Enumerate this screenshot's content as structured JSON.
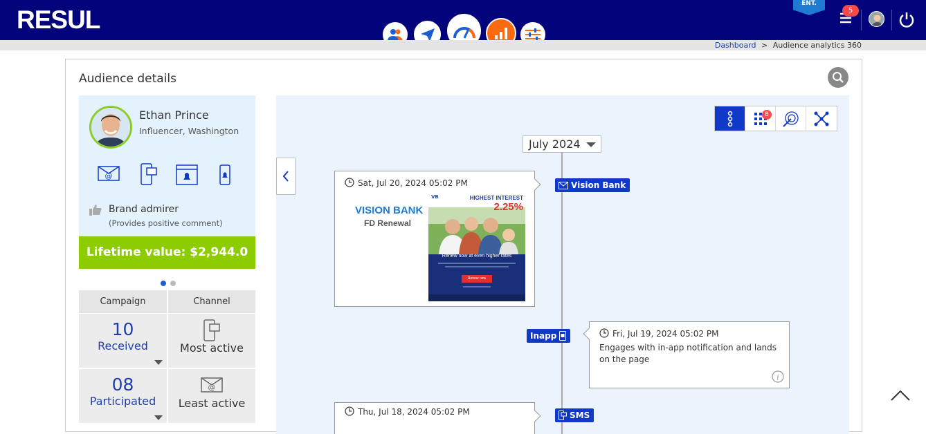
{
  "header": {
    "logo": "RESUL",
    "ent_badge": "ENT.",
    "notification_count": "5"
  },
  "breadcrumb": {
    "home": "Dashboard",
    "separator": ">",
    "current": "Audience analytics 360"
  },
  "card": {
    "title": "Audience details"
  },
  "profile": {
    "name": "Ethan Prince",
    "subtitle": "Influencer, Washington",
    "persona": "Brand admirer",
    "persona_note": "(Provides positive comment)",
    "lifetime_value": "Lifetime value: $2,944.0"
  },
  "stats": {
    "campaign_header": "Campaign",
    "channel_header": "Channel",
    "received_count": "10",
    "received_label": "Received",
    "most_active_label": "Most active",
    "participated_count": "08",
    "participated_label": "Participated",
    "least_active_label": "Least active"
  },
  "timeline": {
    "month": "July 2024",
    "filter_badge": "8",
    "events": [
      {
        "time": "Sat, Jul 20, 2024 05:02 PM",
        "channel": "Vision Bank",
        "brand": "VISION BANK",
        "campaign": "FD Renewal",
        "banner_headline": "HIGHEST INTEREST",
        "banner_rate": "2.25%",
        "banner_cta_text": "Renew now at even higher rates",
        "banner_button": "Renew now"
      },
      {
        "time": "Fri, Jul 19, 2024 05:02 PM",
        "channel": "Inapp",
        "description": "Engages with in-app notification and lands on the page"
      },
      {
        "time": "Thu, Jul 18, 2024 05:02 PM",
        "channel": "SMS"
      }
    ]
  },
  "colors": {
    "header_bg": "#03037c",
    "accent_orange": "#fa6a10",
    "lifetime_green": "#8ccc00",
    "tag_blue": "#1039c8",
    "timeline_bg": "#ebf4fc"
  }
}
